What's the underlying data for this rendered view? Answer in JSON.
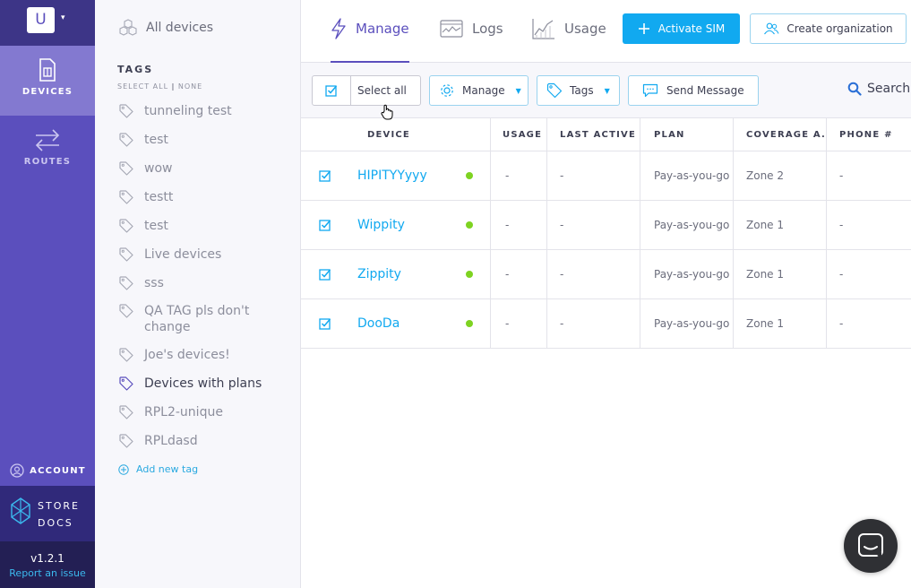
{
  "org": {
    "initial": "U",
    "caret": "▾"
  },
  "rail": {
    "devices_label": "DEVICES",
    "routes_label": "ROUTES",
    "account_label": "ACCOUNT",
    "store_line1": "STORE",
    "store_line2": "DOCS",
    "version": "v1.2.1",
    "report_issue": "Report an issue"
  },
  "tags_panel": {
    "all_devices": "All devices",
    "heading": "TAGS",
    "select_all": "SELECT ALL",
    "separator": "|",
    "none": "NONE",
    "items": [
      {
        "label": "tunneling test"
      },
      {
        "label": "test"
      },
      {
        "label": "wow"
      },
      {
        "label": "testt"
      },
      {
        "label": "test"
      },
      {
        "label": "Live devices"
      },
      {
        "label": "sss"
      },
      {
        "label": "QA TAG pls don't change"
      },
      {
        "label": "Joe's devices!"
      },
      {
        "label": "Devices with plans"
      },
      {
        "label": "RPL2-unique"
      },
      {
        "label": "RPLdasd"
      }
    ],
    "active_index": 9,
    "add_tag": "Add new tag"
  },
  "top_nav": {
    "tabs": [
      {
        "label": "Manage"
      },
      {
        "label": "Logs"
      },
      {
        "label": "Usage"
      }
    ],
    "activate_sim": "Activate SIM",
    "create_org": "Create organization"
  },
  "toolbar": {
    "select_all": "Select all",
    "manage": "Manage",
    "tags": "Tags",
    "send_message": "Send Message",
    "search": "Search"
  },
  "table": {
    "headers": {
      "device": "DEVICE",
      "usage": "USAGE",
      "last_active": "LAST ACTIVE",
      "plan": "PLAN",
      "coverage": "COVERAGE A...",
      "phone": "PHONE #"
    },
    "rows": [
      {
        "device": "HIPITYYyyy",
        "usage": "-",
        "last_active": "-",
        "plan": "Pay-as-you-go",
        "coverage": "Zone 2",
        "phone": "-"
      },
      {
        "device": "Wippity",
        "usage": "-",
        "last_active": "-",
        "plan": "Pay-as-you-go",
        "coverage": "Zone 1",
        "phone": "-"
      },
      {
        "device": "Zippity",
        "usage": "-",
        "last_active": "-",
        "plan": "Pay-as-you-go",
        "coverage": "Zone 1",
        "phone": "-"
      },
      {
        "device": "DooDa",
        "usage": "-",
        "last_active": "-",
        "plan": "Pay-as-you-go",
        "coverage": "Zone 1",
        "phone": "-"
      }
    ]
  },
  "colors": {
    "brand_purple": "#5b4fbd",
    "accent_blue": "#11a9f0",
    "online_green": "#7ed321"
  }
}
